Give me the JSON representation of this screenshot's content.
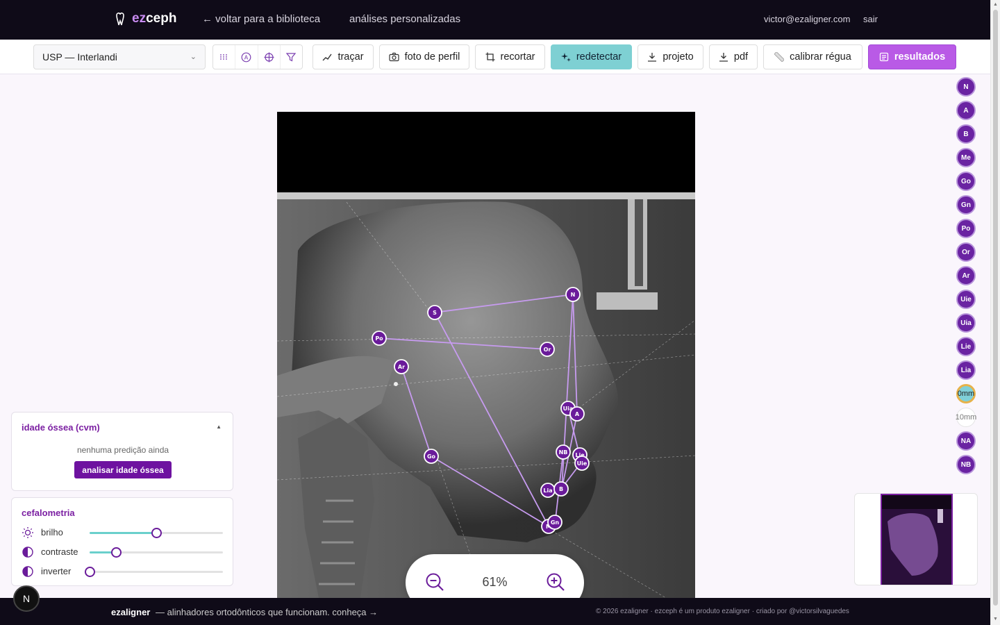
{
  "app": {
    "brand_ez": "ez",
    "brand_ceph": "ceph"
  },
  "nav": {
    "back": "← voltar para a biblioteca",
    "custom": "análises personalizadas",
    "email": "victor@ezaligner.com",
    "logout": "sair"
  },
  "toolbar": {
    "analysis_select": "USP — Interlandi",
    "trace": "traçar",
    "profile_photo": "foto de perfil",
    "crop": "recortar",
    "redetect": "redetectar",
    "project": "projeto",
    "pdf": "pdf",
    "calibrate": "calibrar régua",
    "results": "resultados",
    "icons": [
      "grid-icon",
      "a-circle-icon",
      "crosshair-icon",
      "filter-icon"
    ]
  },
  "landmarks": {
    "sidebar": [
      "N",
      "A",
      "B",
      "Me",
      "Go",
      "Gn",
      "Po",
      "Or",
      "Ar",
      "Uie",
      "Uia",
      "Lie",
      "Lia",
      "0mm",
      "10mm",
      "NA",
      "NB"
    ],
    "on_image": {
      "s": "S",
      "n": "N",
      "po": "Po",
      "or": "Or",
      "ar": "Ar",
      "uia": "Uia",
      "a": "A",
      "nb": "NB",
      "lie": "Lie",
      "uie": "Uie",
      "go": "Go",
      "lia": "Lia",
      "b": "B",
      "m": "M",
      "gn": "Gn"
    }
  },
  "cvm_panel": {
    "title": "idade óssea (cvm)",
    "empty": "nenhuma predição ainda",
    "button": "analisar idade óssea"
  },
  "ceph_panel": {
    "title": "cefalometria",
    "brightness_label": "brilho",
    "brightness_value": 0.5,
    "contrast_label": "contraste",
    "contrast_value": 0.2,
    "invert_label": "inverter",
    "invert_value": 0
  },
  "zoom": {
    "value": "61%"
  },
  "footer": {
    "brand": "ezaligner",
    "tagline": "— alinhadores ortodônticos que funcionam. conheça  →",
    "copyright": "© 2026 ezaligner · ezceph é um produto ezaligner · criado por @victorsilvaguedes"
  },
  "badge": {
    "letter": "N"
  },
  "colors": {
    "accent": "#7b1fa2",
    "teal": "#7ed0d3",
    "results": "#b95ae6",
    "nav_bg": "#0f0b18"
  }
}
